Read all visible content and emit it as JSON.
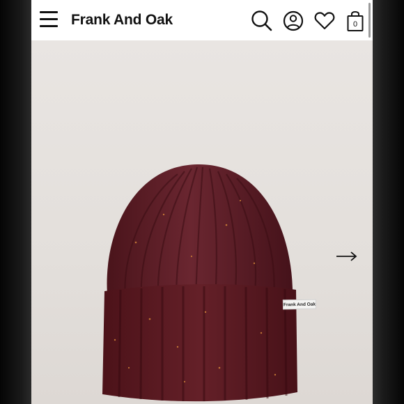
{
  "header": {
    "brand": "Frank And Oak",
    "cart_count": "0",
    "icons": [
      "menu-icon",
      "search-icon",
      "account-icon",
      "heart-icon",
      "cart-icon"
    ]
  },
  "product": {
    "label_text": "Frank And Oak",
    "next_icon": "arrow-right-icon"
  },
  "colors": {
    "beanie": "#5a1a22",
    "background": "#e6e2df",
    "brand_text": "#111111"
  }
}
